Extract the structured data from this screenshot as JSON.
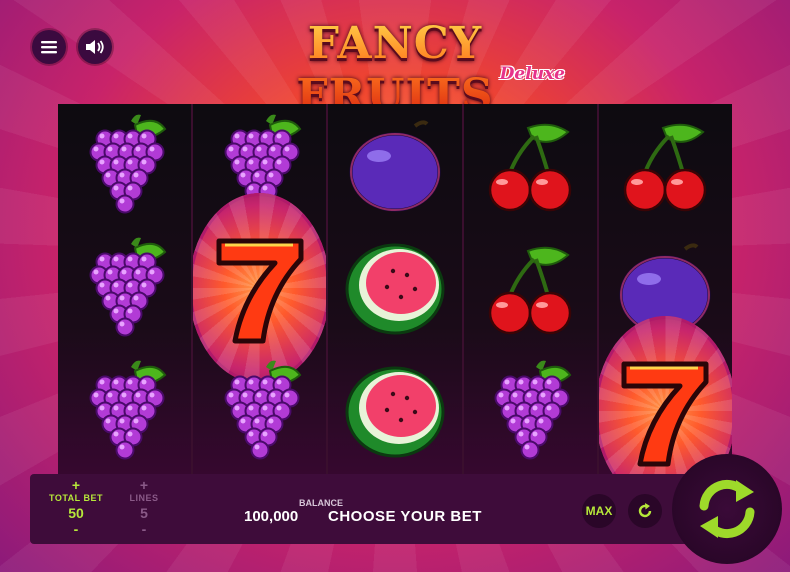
{
  "header": {
    "menu_icon": "hamburger-menu-icon",
    "sound_icon": "speaker-volume-icon",
    "logo_title": "FANCY FRUITS",
    "logo_subtitle": "Deluxe"
  },
  "reels": [
    [
      "grapes",
      "grapes",
      "grapes"
    ],
    [
      "grapes",
      "seven",
      "grapes"
    ],
    [
      "plum",
      "watermelon",
      "watermelon"
    ],
    [
      "cherries",
      "cherries",
      "grapes"
    ],
    [
      "cherries",
      "plum",
      "seven"
    ]
  ],
  "controls": {
    "total_bet": {
      "label": "TOTAL BET",
      "value": "50",
      "plus": "+",
      "minus": "-"
    },
    "lines": {
      "label": "LINES",
      "value": "5",
      "plus": "+",
      "minus": "-"
    },
    "balance": {
      "label": "BALANCE",
      "value": "100,000"
    },
    "message": "CHOOSE YOUR BET",
    "max_label": "MAX",
    "autoplay_icon": "autoplay-refresh-icon",
    "spin_icon": "spin-arrows-icon"
  },
  "colors": {
    "accent_green": "#b6e83a",
    "panel": "#3e0c3a",
    "logo_orange": "#ff5a1f",
    "deluxe_pink": "#e6338a"
  }
}
